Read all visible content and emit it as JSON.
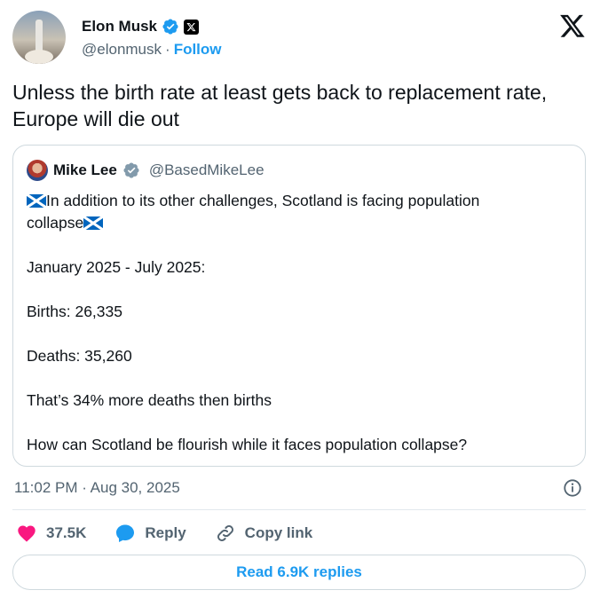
{
  "author": {
    "name": "Elon Musk",
    "handle": "@elonmusk",
    "separator": "·",
    "follow_label": "Follow"
  },
  "tweet": {
    "text": "Unless the birth rate at least gets back to replacement rate, Europe will die out"
  },
  "quoted": {
    "name": "Mike Lee",
    "handle": "@BasedMikeLee",
    "lines": {
      "l1": "In addition to its other challenges, Scotland is facing population",
      "l2": "collapse",
      "period": "January 2025 - July 2025:",
      "births": "Births: 26,335",
      "deaths": "Deaths: 35,260",
      "compare": "That’s 34% more deaths then births",
      "question": "How can Scotland be flourish while it faces population collapse?"
    }
  },
  "meta": {
    "timestamp": "11:02 PM · Aug 30, 2025"
  },
  "actions": {
    "likes": "37.5K",
    "reply_label": "Reply",
    "copy_label": "Copy link"
  },
  "read_replies": "Read 6.9K replies",
  "icons": [
    "verified-badge-icon",
    "x-affiliate-icon",
    "x-logo-icon",
    "scotland-flag-icon",
    "info-icon",
    "heart-icon",
    "reply-icon",
    "link-icon"
  ],
  "colors": {
    "accent": "#1d9bf0",
    "like": "#f91880",
    "text": "#0f1419",
    "muted": "#536471"
  }
}
